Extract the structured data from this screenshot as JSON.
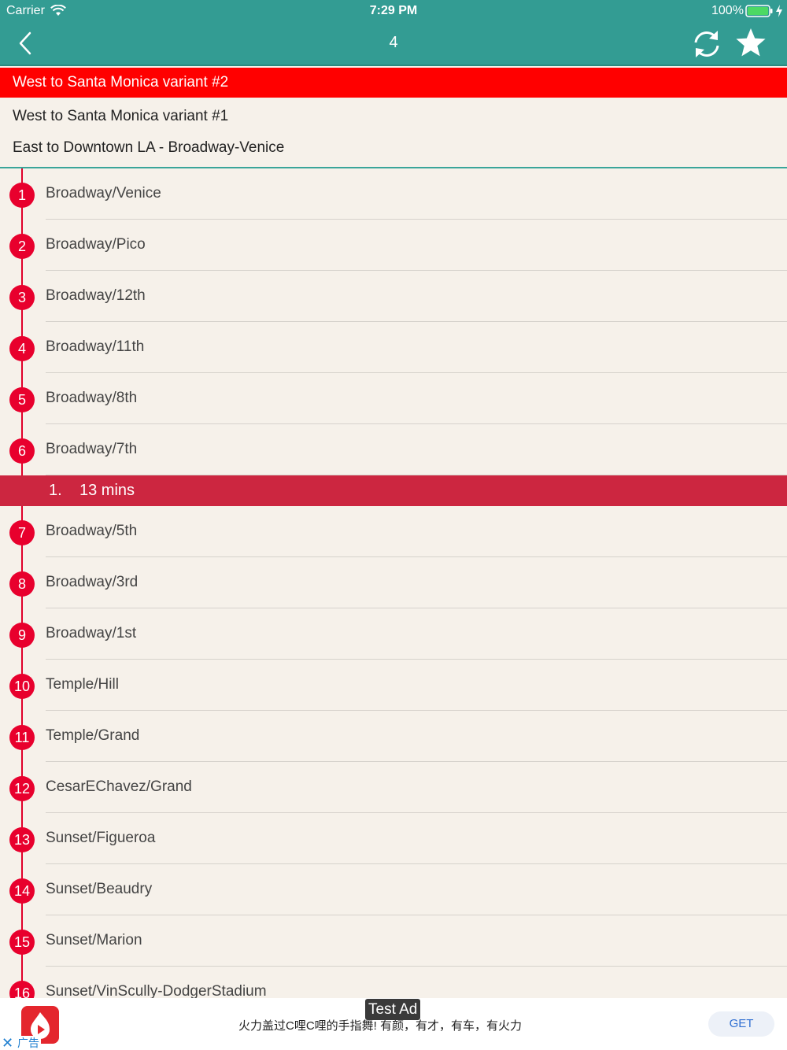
{
  "status_bar": {
    "carrier": "Carrier",
    "time": "7:29 PM",
    "battery_percent": "100%",
    "battery_level": 1.0
  },
  "nav": {
    "title": "4",
    "back_icon": "chevron-left-icon",
    "refresh_icon": "refresh-icon",
    "favorite_icon": "star-icon"
  },
  "variants": [
    {
      "label": "West to Santa Monica variant #2",
      "selected": true
    },
    {
      "label": "West to Santa Monica variant #1",
      "selected": false
    },
    {
      "label": "East to Downtown LA - Broadway-Venice",
      "selected": false
    }
  ],
  "stops": [
    {
      "num": "1",
      "name": "Broadway/Venice"
    },
    {
      "num": "2",
      "name": "Broadway/Pico"
    },
    {
      "num": "3",
      "name": "Broadway/12th"
    },
    {
      "num": "4",
      "name": "Broadway/11th"
    },
    {
      "num": "5",
      "name": "Broadway/8th"
    },
    {
      "num": "6",
      "name": "Broadway/7th"
    },
    {
      "num": "7",
      "name": "Broadway/5th"
    },
    {
      "num": "8",
      "name": "Broadway/3rd"
    },
    {
      "num": "9",
      "name": "Broadway/1st"
    },
    {
      "num": "10",
      "name": "Temple/Hill"
    },
    {
      "num": "11",
      "name": "Temple/Grand"
    },
    {
      "num": "12",
      "name": "CesarEChavez/Grand"
    },
    {
      "num": "13",
      "name": "Sunset/Figueroa"
    },
    {
      "num": "14",
      "name": "Sunset/Beaudry"
    },
    {
      "num": "15",
      "name": "Sunset/Marion"
    },
    {
      "num": "16",
      "name": "Sunset/VinScully-DodgerStadium"
    }
  ],
  "arrival": {
    "after_stop": "6",
    "index": "1.",
    "time": "13 mins"
  },
  "ad": {
    "badge": "Test Ad",
    "text": "火力盖过C哩C哩的手指舞! 有颜，有才，有车，有火力",
    "cta": "GET",
    "label": "广告",
    "close_glyph": "✕"
  },
  "colors": {
    "header": "#339c93",
    "selected_variant": "#ff0000",
    "stop_badge": "#e8002d",
    "arrival_bar": "#cc2640",
    "background": "#f6f1ea"
  }
}
